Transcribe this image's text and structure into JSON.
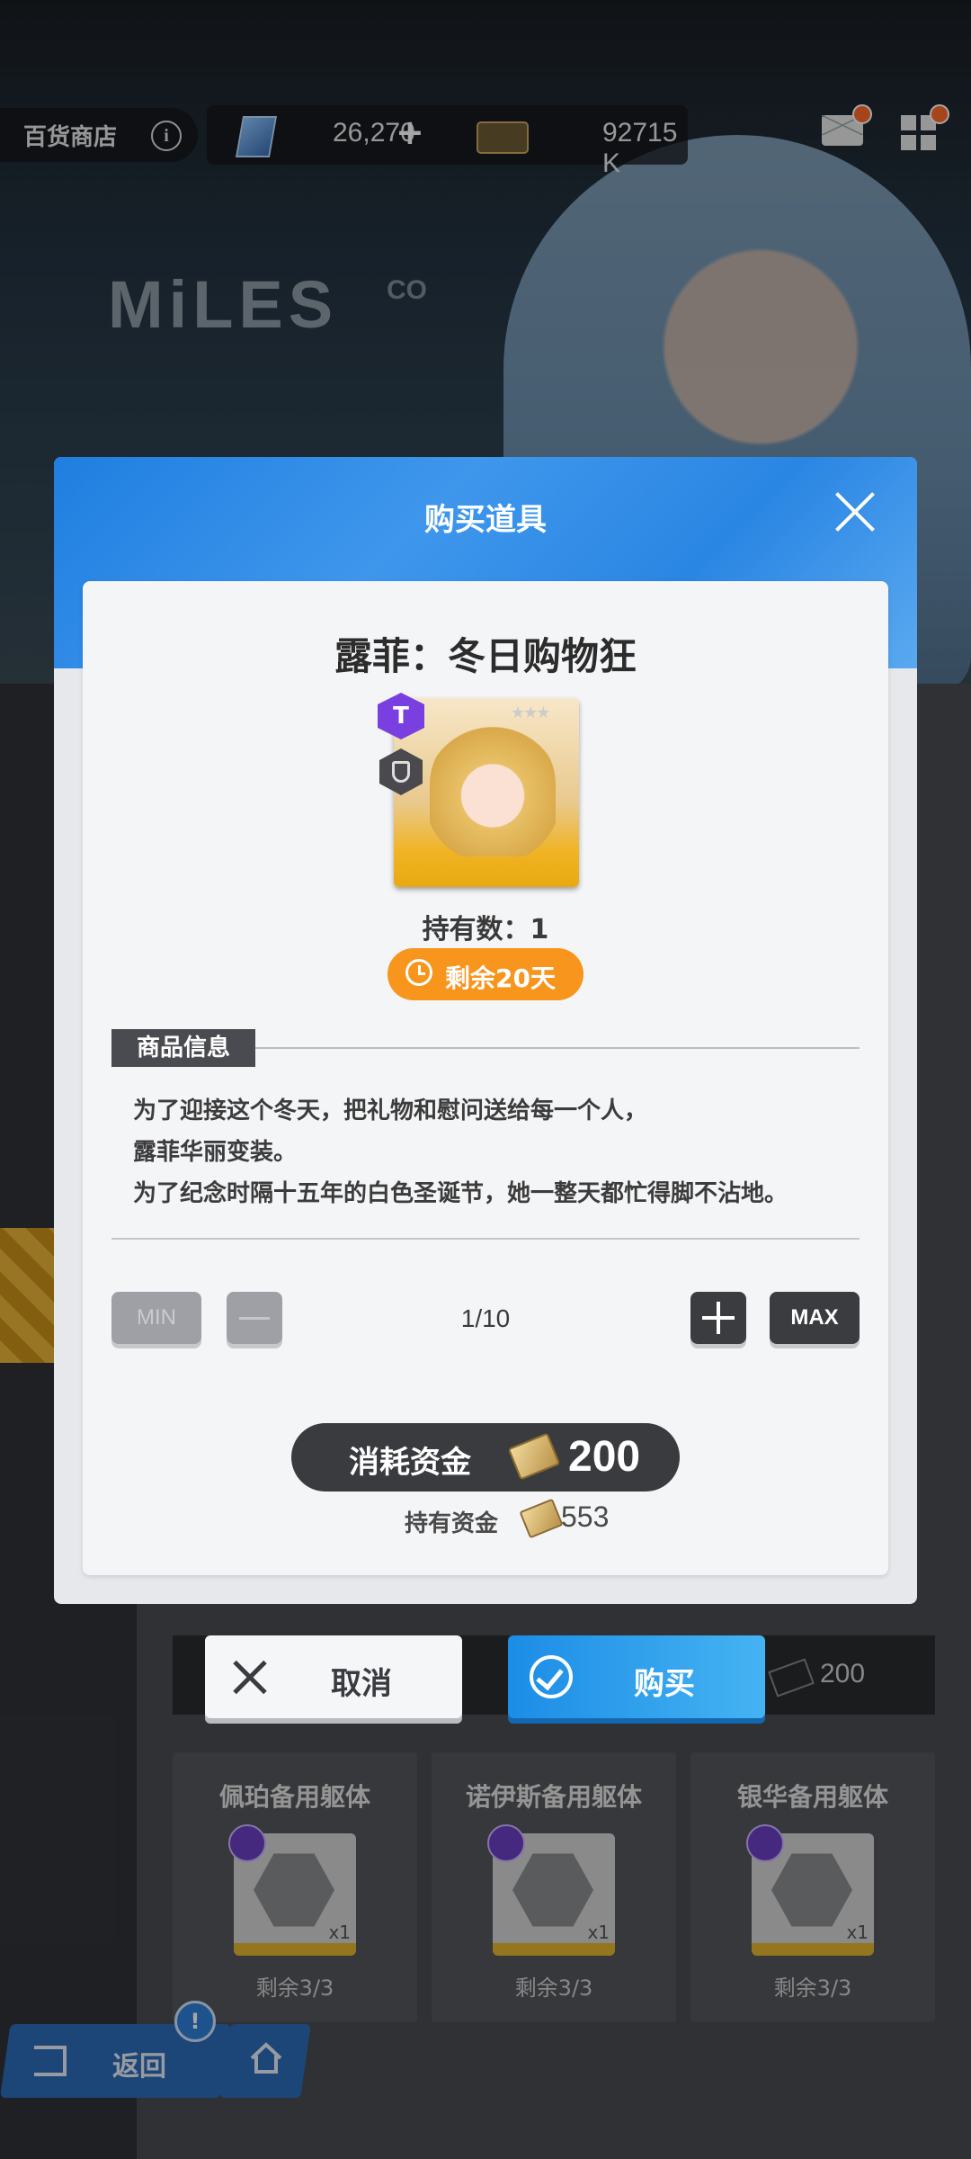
{
  "topbar": {
    "shop_name": "百货商店",
    "gem_amount": "26,270",
    "plus": "+",
    "ticket_amount": "92715 K"
  },
  "background": {
    "logo": "MiLES",
    "logo_co": "CO",
    "strip_price": "200",
    "cards": [
      {
        "name": "佩珀备用躯体",
        "qty": "x1",
        "remaining": "剩余3/3"
      },
      {
        "name": "诺伊斯备用躯体",
        "qty": "x1",
        "remaining": "剩余3/3"
      },
      {
        "name": "银华备用躯体",
        "qty": "x1",
        "remaining": "剩余3/3"
      }
    ],
    "back_label": "返回",
    "alert": "!"
  },
  "modal": {
    "title": "购买道具",
    "item_name": "露菲：冬日购物狂",
    "class_badge": "T",
    "owned": "持有数：1",
    "remaining": "剩余20天",
    "info_tag": "商品信息",
    "description": [
      "为了迎接这个冬天，把礼物和慰问送给每一个人，",
      "露菲华丽变装。",
      "为了纪念时隔十五年的白色圣诞节，她一整天都忙得脚不沾地。"
    ],
    "min_label": "MIN",
    "max_label": "MAX",
    "quantity": "1/10",
    "cost_label": "消耗资金",
    "cost_value": "200",
    "hold_label": "持有资金",
    "hold_value": "553"
  },
  "actions": {
    "cancel_label": "取消",
    "buy_label": "购买"
  },
  "colors": {
    "header_blue": "#2a86e3",
    "remain_orange": "#f7951d",
    "buy_blue": "#1c8de6",
    "dark_button": "#3b3c40"
  }
}
